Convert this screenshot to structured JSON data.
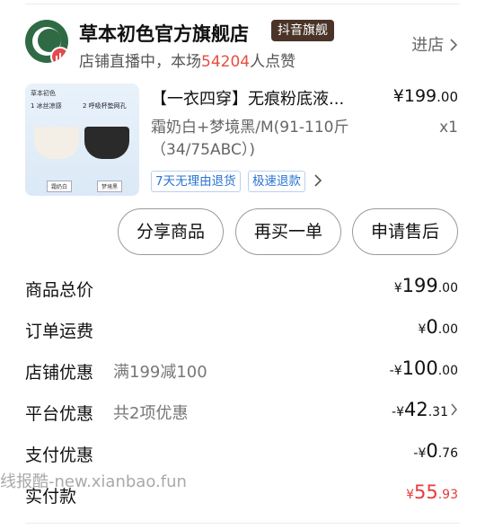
{
  "shop": {
    "name": "草本初色官方旗舰店",
    "badge": "抖音旗舰",
    "live_prefix": "店铺直播中，本场",
    "live_count": "54204",
    "live_suffix": "人点赞",
    "enter": "进店",
    "accent_green": "#2f6a45",
    "accent_red": "#e84e3f"
  },
  "product": {
    "thumb": {
      "brand": "草本初色",
      "tag1": "1 冰丝凉感",
      "tag2": "2 呼吸杯垫网孔",
      "label1": "霜奶白",
      "label2": "梦境黑"
    },
    "title": "【一衣四穿】无痕粉底液...",
    "price_main": "¥199",
    "price_dec": ".00",
    "spec": "霜奶白+梦境黑/M(91-110斤（34/75ABC）)",
    "qty": "x1",
    "services": [
      "7天无理由退货",
      "极速退款"
    ]
  },
  "actions": [
    "分享商品",
    "再买一单",
    "申请售后"
  ],
  "summary": {
    "goods_total": {
      "label": "商品总价",
      "cur": "¥",
      "int": "199",
      "dec": ".00"
    },
    "shipping": {
      "label": "订单运费",
      "cur": "¥",
      "int": "0",
      "dec": ".00"
    },
    "shop_discount": {
      "label": "店铺优惠",
      "note": "满199减100",
      "cur": "-¥",
      "int": "100",
      "dec": ".00"
    },
    "platform_discount": {
      "label": "平台优惠",
      "note": "共2项优惠",
      "cur": "-¥",
      "int": "42",
      "dec": ".31"
    },
    "payment_discount": {
      "label": "支付优惠",
      "cur": "-¥",
      "int": "0",
      "dec": ".76"
    },
    "paid": {
      "label": "实付款",
      "cur": "¥",
      "int": "55",
      "dec": ".93"
    }
  },
  "watermark": "线报酷-new.xianbao.fun"
}
